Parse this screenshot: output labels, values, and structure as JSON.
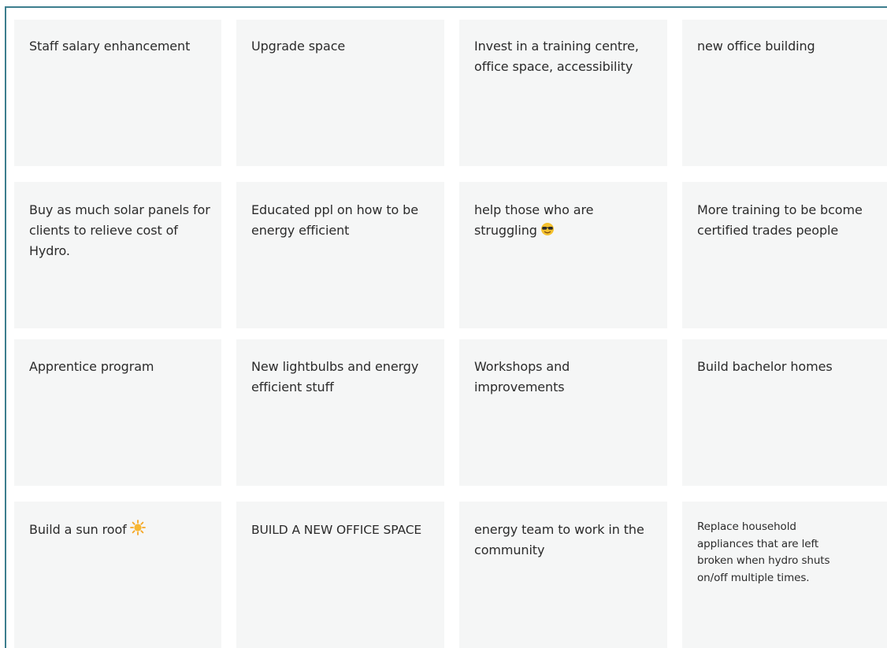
{
  "board": {
    "cards": [
      {
        "text": "Staff salary enhancement"
      },
      {
        "text": "Upgrade space"
      },
      {
        "text": "Invest in a training centre, office space, accessibility"
      },
      {
        "text": "new office building"
      },
      {
        "text": "Buy as much solar panels for clients to relieve cost of Hydro."
      },
      {
        "text": "Educated ppl on how to be energy efficient"
      },
      {
        "text": "help those who are struggling",
        "emoji": "sunglasses-emoji"
      },
      {
        "text": "More training to be bcome certified trades people"
      },
      {
        "text": "Apprentice program"
      },
      {
        "text": "New lightbulbs and energy efficient stuff"
      },
      {
        "text": "Workshops and improvements"
      },
      {
        "text": "Build bachelor homes"
      },
      {
        "text": "Build a sun roof",
        "emoji": "sun-emoji"
      },
      {
        "text": "BUILD A NEW OFFICE SPACE"
      },
      {
        "text": "energy team to work in the community"
      },
      {
        "text": "Replace household appliances that are left broken when hydro shuts on/off multiple times."
      }
    ]
  }
}
